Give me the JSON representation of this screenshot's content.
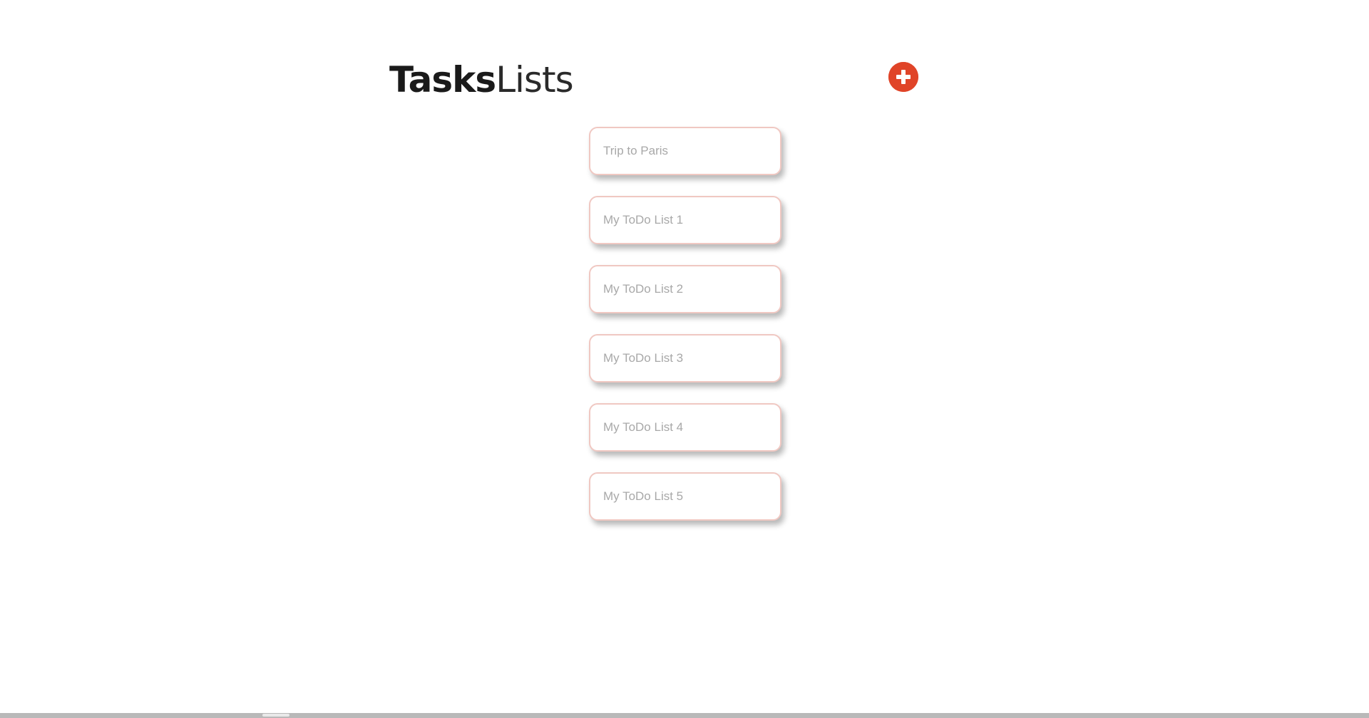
{
  "header": {
    "title_bold": "Tasks",
    "title_light": "Lists",
    "add_icon": "plus-circle-icon",
    "accent_color": "#e04428"
  },
  "lists": [
    {
      "label": "Trip to Paris"
    },
    {
      "label": "My ToDo List 1"
    },
    {
      "label": "My ToDo List 2"
    },
    {
      "label": "My ToDo List 3"
    },
    {
      "label": "My ToDo List 4"
    },
    {
      "label": "My ToDo List 5"
    }
  ],
  "colors": {
    "card_border": "#f0c8c2",
    "label_text": "#a8a8a8",
    "title_text": "#1a1a1a"
  }
}
